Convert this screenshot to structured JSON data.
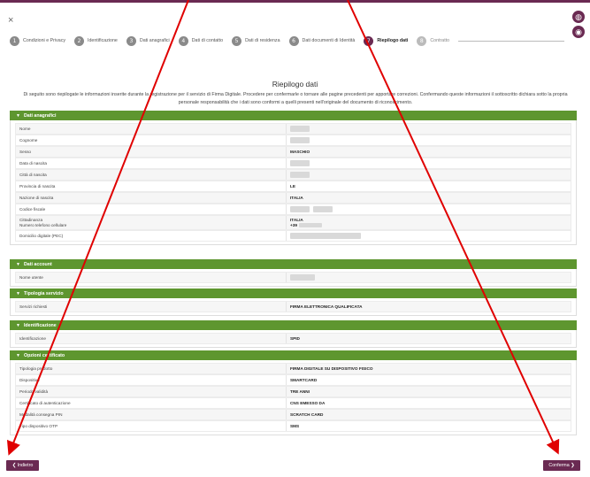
{
  "window": {
    "close_symbol": "×"
  },
  "steps": [
    {
      "num": "1",
      "label": "Condizioni e Privacy"
    },
    {
      "num": "2",
      "label": "Identificazione"
    },
    {
      "num": "3",
      "label": "Dati anagrafici"
    },
    {
      "num": "4",
      "label": "Dati di contatto"
    },
    {
      "num": "5",
      "label": "Dati di residenza"
    },
    {
      "num": "6",
      "label": "Dati documenti di Identità"
    },
    {
      "num": "7",
      "label": "Riepilogo dati"
    },
    {
      "num": "8",
      "label": "Contratto"
    }
  ],
  "page": {
    "title": "Riepilogo dati",
    "intro": "Di seguito sono riepilogate le informazioni inserite durante la registrazione per il servizio di Firma Digitale. Procedere per confermarle o tornare alle pagine precedenti per apportare correzioni. Confermando queste informazioni il sottoscritto dichiara sotto la propria personale responsabilità che i dati sono conformi a quelli presenti nell'originale del documento di riconoscimento."
  },
  "sections": {
    "anagrafici": {
      "title": "Dati anagrafici",
      "rows": [
        {
          "key": "Nome",
          "value": ""
        },
        {
          "key": "Cognome",
          "value": ""
        },
        {
          "key": "Sesso",
          "value": "MASCHIO"
        },
        {
          "key": "Data di nascita",
          "value": ""
        },
        {
          "key": "Città di nascita",
          "value": ""
        },
        {
          "key": "Provincia di nascita",
          "value": "LE"
        },
        {
          "key": "Nazione di nascita",
          "value": "ITALIA"
        },
        {
          "key": "Codice fiscale",
          "value": ""
        },
        {
          "key": "Cittadinanza",
          "key2": "Numero telefono cellulare",
          "value": "ITALIA",
          "value2": "+39"
        },
        {
          "key": "Domicilio digitale (PEC)",
          "value": ""
        }
      ]
    },
    "account": {
      "title": "Dati account",
      "rows": [
        {
          "key": "Nome utente",
          "value": ""
        }
      ]
    },
    "servizio": {
      "title": "Tipologia servizio",
      "rows": [
        {
          "key": "Servizi richiesti",
          "value": "FIRMA ELETTRONICA QUALIFICATA"
        }
      ]
    },
    "identificazione": {
      "title": "Identificazione",
      "rows": [
        {
          "key": "Identificazione",
          "value": "SPID"
        }
      ]
    },
    "opzioni": {
      "title": "Opzioni certificato",
      "rows": [
        {
          "key": "Tipologia prodotto",
          "value": "FIRMA DIGITALE SU DISPOSITIVO FISICO"
        },
        {
          "key": "Dispositivo",
          "value": "SMARTCARD"
        },
        {
          "key": "Periodo validità",
          "value": "TRE ANNI"
        },
        {
          "key": "Certificato di autenticazione",
          "value": "CNS EMESSO DA"
        },
        {
          "key": "Modalità consegna PIN",
          "value": "SCRATCH CARD"
        },
        {
          "key": "Tipo dispositivo OTP",
          "value": "SMS"
        }
      ]
    }
  },
  "buttons": {
    "back": "❮  Indietro",
    "confirm": "Conferma  ❯"
  },
  "colors": {
    "accent": "#6a2a52",
    "section_green": "#5e962f",
    "annotation_red": "#e00000"
  }
}
